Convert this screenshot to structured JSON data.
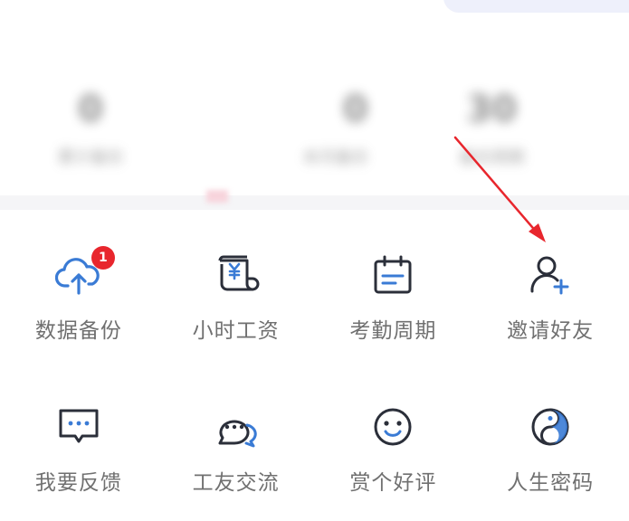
{
  "stats": [
    {
      "value": "0",
      "label": "累计备份"
    },
    {
      "value": "0",
      "label": "本月备份"
    },
    {
      "value": "30",
      "label": "备份周期"
    }
  ],
  "tools": [
    {
      "label": "数据备份",
      "icon": "cloud-upload-icon",
      "badge": "1"
    },
    {
      "label": "小时工资",
      "icon": "yuan-scroll-icon"
    },
    {
      "label": "考勤周期",
      "icon": "calendar-icon"
    },
    {
      "label": "邀请好友",
      "icon": "add-user-icon"
    },
    {
      "label": "我要反馈",
      "icon": "feedback-chat-icon"
    },
    {
      "label": "工友交流",
      "icon": "chat-bubbles-icon"
    },
    {
      "label": "赏个好评",
      "icon": "smile-icon"
    },
    {
      "label": "人生密码",
      "icon": "yin-yang-icon"
    }
  ],
  "colors": {
    "icon_dark": "#2b2f3a",
    "icon_accent": "#3a7bd5",
    "badge": "#e8262d",
    "annotation_arrow": "#e8262d"
  }
}
